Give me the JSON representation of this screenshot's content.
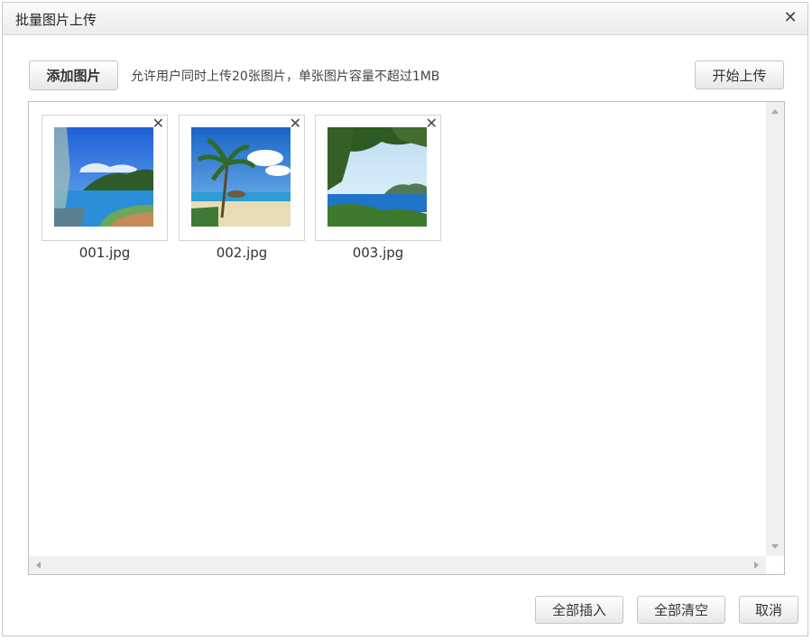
{
  "dialog": {
    "title": "批量图片上传"
  },
  "toolbar": {
    "add_label": "添加图片",
    "tip": "允许用户同时上传20张图片，单张图片容量不超过1MB",
    "start_label": "开始上传"
  },
  "files": [
    {
      "name": "001.jpg",
      "scene": "lake-coast"
    },
    {
      "name": "002.jpg",
      "scene": "beach-palm"
    },
    {
      "name": "003.jpg",
      "scene": "sea-bay"
    }
  ],
  "icons": {
    "close": "close-icon",
    "remove": "remove-icon"
  },
  "footer": {
    "insert_all_label": "全部插入",
    "clear_all_label": "全部清空",
    "cancel_label": "取消"
  }
}
